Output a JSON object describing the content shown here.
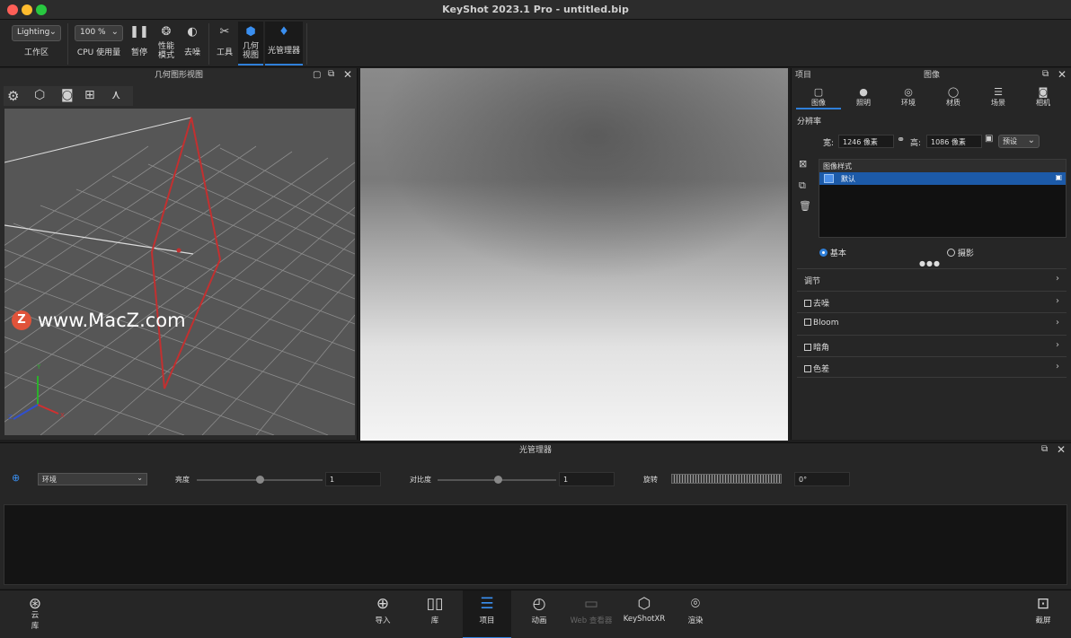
{
  "window": {
    "title": "KeyShot 2023.1 Pro  - untitled.bip"
  },
  "colors": {
    "accent": "#2f7fd8",
    "selection": "#1c5aa8",
    "geometry_outline": "#c23030"
  },
  "toolbar": {
    "workspace_value": "Lighting",
    "workspace_label": "工作区",
    "cpu_value": "100 %",
    "cpu_label": "CPU 使用量",
    "pause_label": "暂停",
    "perf_label_1": "性能",
    "perf_label_2": "模式",
    "denoise_label": "去噪",
    "tools_label": "工具",
    "geo_view_label_1": "几何",
    "geo_view_label_2": "视图",
    "light_manager_label": "光管理器"
  },
  "geometry_panel": {
    "title": "几何图形视图",
    "watermark": "www.MacZ.com",
    "watermark_badge": "Z",
    "axis_y": "Y",
    "axis_z": "Z",
    "axis_x": "X"
  },
  "project_panel": {
    "left_title": "项目",
    "title": "图像",
    "tabs": [
      {
        "label": "图像",
        "icon": "image-icon",
        "glyph": "▢"
      },
      {
        "label": "照明",
        "icon": "bulb-icon",
        "glyph": "●"
      },
      {
        "label": "环境",
        "icon": "globe-icon",
        "glyph": "◎"
      },
      {
        "label": "材质",
        "icon": "material-icon",
        "glyph": "◯"
      },
      {
        "label": "场景",
        "icon": "scene-icon",
        "glyph": "☰"
      },
      {
        "label": "相机",
        "icon": "camera-icon",
        "glyph": "◙"
      }
    ],
    "resolution_label": "分辨率",
    "width_label": "宽:",
    "width_value": "1246 像素",
    "height_label": "高:",
    "height_value": "1086 像素",
    "preset_value": "预设",
    "styles_header": "图像样式",
    "style_default": "默认",
    "mode_basic": "基本",
    "mode_photo": "摄影",
    "more_dots": "●●●",
    "sections": [
      "调节",
      "去噪",
      "Bloom",
      "暗角",
      "色差"
    ]
  },
  "light_manager": {
    "title": "光管理器",
    "env_value": "环境",
    "brightness_label": "亮度",
    "brightness_value": "1",
    "contrast_label": "对比度",
    "contrast_value": "1",
    "rotation_label": "旋转",
    "rotation_value": "0°"
  },
  "bottom_bar": {
    "cloud_label_1": "云",
    "cloud_label_2": "库",
    "items": [
      {
        "label": "导入",
        "icon": "import-icon",
        "glyph": "⊕"
      },
      {
        "label": "库",
        "icon": "library-icon",
        "glyph": "▯▯"
      },
      {
        "label": "项目",
        "icon": "project-icon",
        "glyph": "☰"
      },
      {
        "label": "动画",
        "icon": "animation-icon",
        "glyph": "◴"
      },
      {
        "label": "Web 查看器",
        "icon": "web-viewer-icon",
        "glyph": "▭"
      },
      {
        "label": "KeyShotXR",
        "icon": "keyshotxr-icon",
        "glyph": "⬡"
      },
      {
        "label": "渲染",
        "icon": "render-icon",
        "glyph": "⌾"
      }
    ],
    "screenshot_label": "截屏"
  }
}
